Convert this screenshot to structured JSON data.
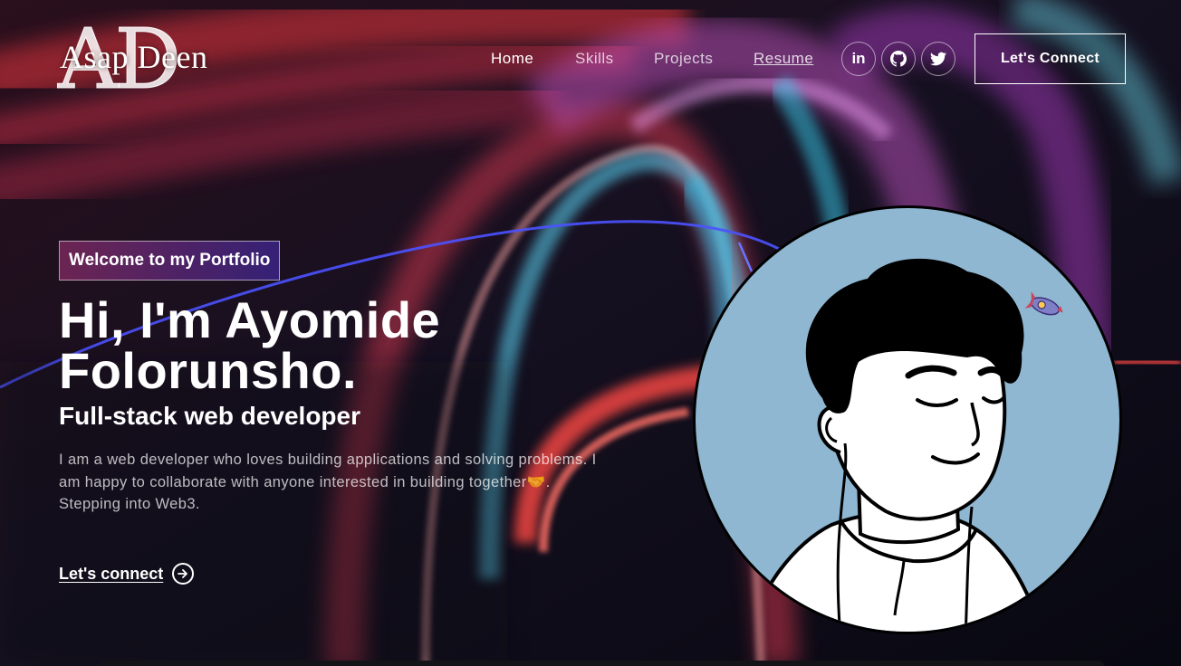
{
  "logo": {
    "monogram": "AD",
    "name": "Asap Deen"
  },
  "nav": {
    "items": [
      {
        "label": "Home"
      },
      {
        "label": "Skills"
      },
      {
        "label": "Projects"
      },
      {
        "label": "Resume"
      }
    ],
    "social": [
      {
        "icon": "linkedin-icon",
        "label": "in"
      },
      {
        "icon": "github-icon"
      },
      {
        "icon": "twitter-icon"
      }
    ],
    "connect_button": "Let's Connect"
  },
  "hero": {
    "tagline": "Welcome to my Portfolio",
    "title_line1": "Hi, I'm Ayomide",
    "title_line2": "Folorunsho.",
    "subtitle": "Full-stack web developer",
    "description_line1": "I am a web developer who loves building applications and solving problems. I",
    "description_line2": "am happy to collaborate with anyone interested in building together🤝.",
    "description_line3": "Stepping into Web3.",
    "cta_label": "Let's connect"
  },
  "colors": {
    "tagline_gradient_start": "#aa367c",
    "tagline_gradient_end": "#4a2fbd",
    "avatar_bg": "#8fb7d2"
  }
}
